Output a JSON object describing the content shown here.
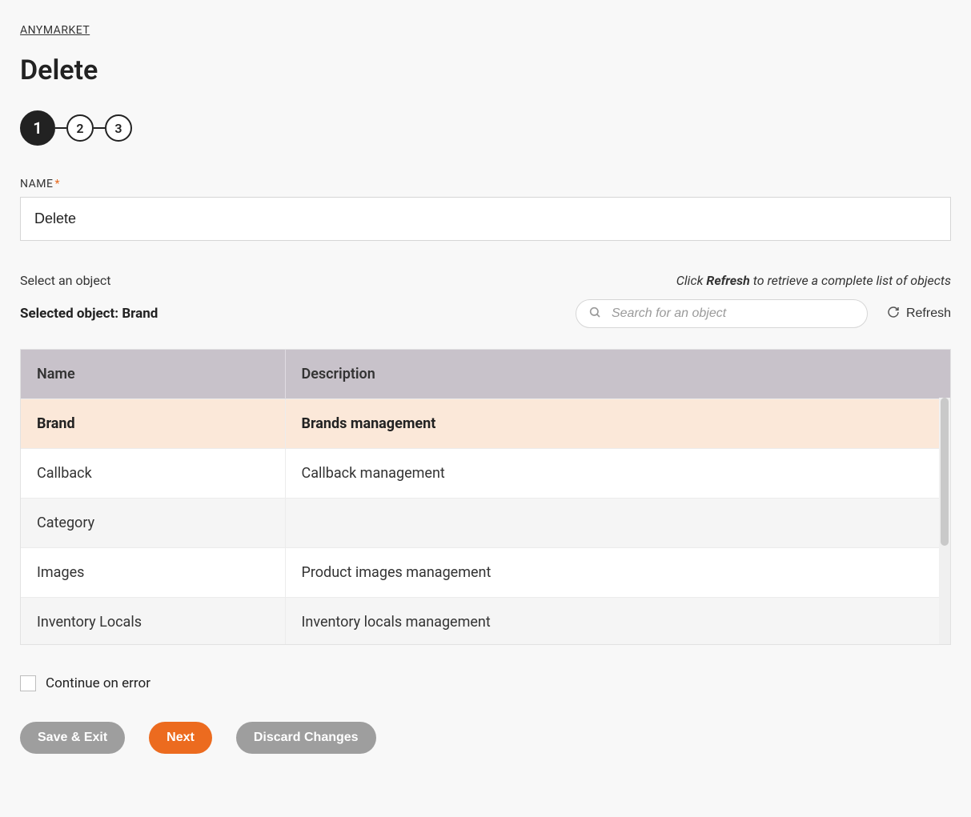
{
  "breadcrumb": "ANYMARKET",
  "page_title": "Delete",
  "stepper": {
    "current": 1,
    "steps": [
      "1",
      "2",
      "3"
    ]
  },
  "name_field": {
    "label": "NAME",
    "required_star": "*",
    "value": "Delete"
  },
  "object_section": {
    "select_label": "Select an object",
    "hint_prefix": "Click ",
    "hint_strong": "Refresh",
    "hint_suffix": " to retrieve a complete list of objects",
    "selected_label_prefix": "Selected object: ",
    "selected_value": "Brand",
    "search_placeholder": "Search for an object",
    "refresh_label": "Refresh"
  },
  "table": {
    "headers": {
      "name": "Name",
      "description": "Description"
    },
    "rows": [
      {
        "name": "Brand",
        "description": "Brands management",
        "selected": true
      },
      {
        "name": "Callback",
        "description": "Callback management",
        "selected": false
      },
      {
        "name": "Category",
        "description": "",
        "selected": false
      },
      {
        "name": "Images",
        "description": "Product images management",
        "selected": false
      },
      {
        "name": "Inventory Locals",
        "description": "Inventory locals management",
        "selected": false
      }
    ]
  },
  "continue_on_error_label": "Continue on error",
  "buttons": {
    "save_exit": "Save & Exit",
    "next": "Next",
    "discard": "Discard Changes"
  }
}
